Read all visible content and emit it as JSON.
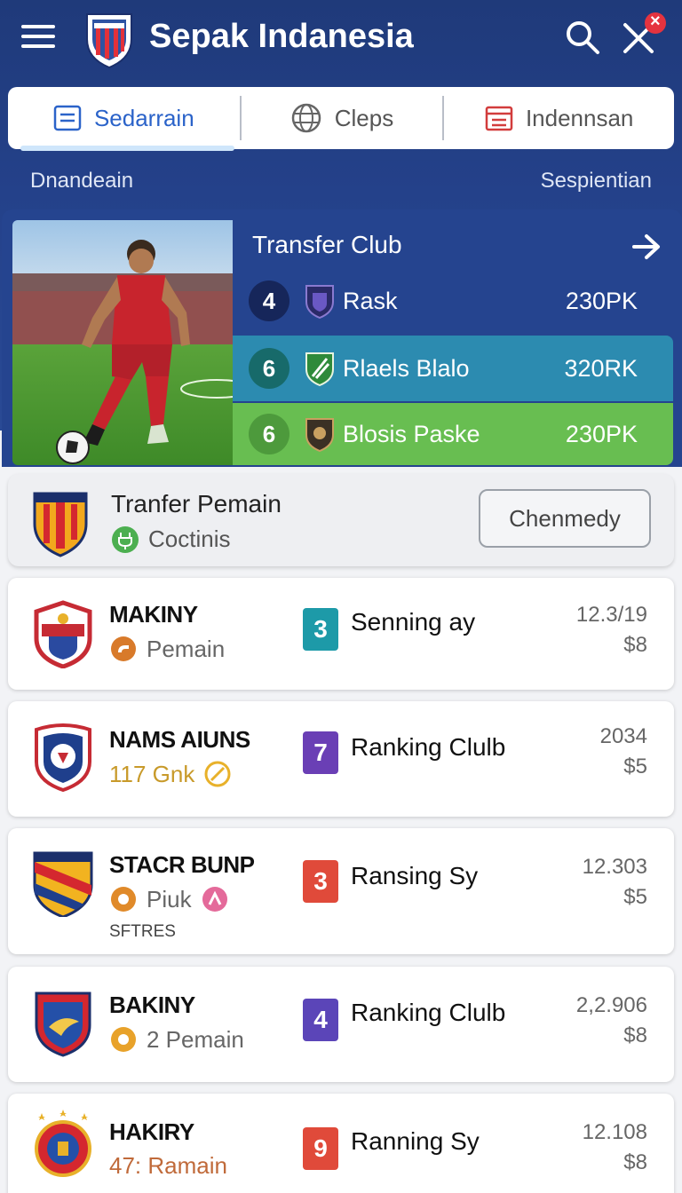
{
  "header": {
    "title": "Sepak Indanesia"
  },
  "tabs": [
    {
      "label": "Sedarrain"
    },
    {
      "label": "Cleps"
    },
    {
      "label": "Indennsan"
    }
  ],
  "subheader": {
    "left": "Dnandeain",
    "right": "Sespientian"
  },
  "featured": {
    "title": "Transfer Club",
    "rows": [
      {
        "rank": "4",
        "name": "Rask",
        "value": "230PK"
      },
      {
        "rank": "6",
        "name": "Rlaels Blalo",
        "value": "320RK"
      },
      {
        "rank": "6",
        "name": "Blosis Paske",
        "value": "230PK"
      }
    ]
  },
  "transfer_card": {
    "title": "Tranfer Pemain",
    "subtitle": "Coctinis",
    "button": "Chenmedy"
  },
  "list": [
    {
      "name": "MAKINY",
      "meta": "Pemain",
      "rank": "3",
      "rank_color": "#1d9aa8",
      "category": "Senning ay",
      "number": "12.3/19",
      "price": "$8",
      "extra": ""
    },
    {
      "name": "NAMS AIUNS",
      "meta": "117 Gnk",
      "rank": "7",
      "rank_color": "#6a3fb5",
      "category": "Ranking Clulb",
      "number": "2034",
      "price": "$5",
      "extra": ""
    },
    {
      "name": "STACR BUNP",
      "meta": "Piuk",
      "rank": "3",
      "rank_color": "#e04a3a",
      "category": "Ransing Sy",
      "number": "12.303",
      "price": "$5",
      "extra": "SFTRES"
    },
    {
      "name": "BAKINY",
      "meta": "2 Pemain",
      "rank": "4",
      "rank_color": "#5b45b8",
      "category": "Ranking Clulb",
      "number": "2,2.906",
      "price": "$8",
      "extra": ""
    },
    {
      "name": "HAKIRY",
      "meta": "47: Ramain",
      "rank": "9",
      "rank_color": "#e04a3a",
      "category": "Ranning Sy",
      "number": "12.108",
      "price": "$8",
      "extra": ""
    }
  ]
}
